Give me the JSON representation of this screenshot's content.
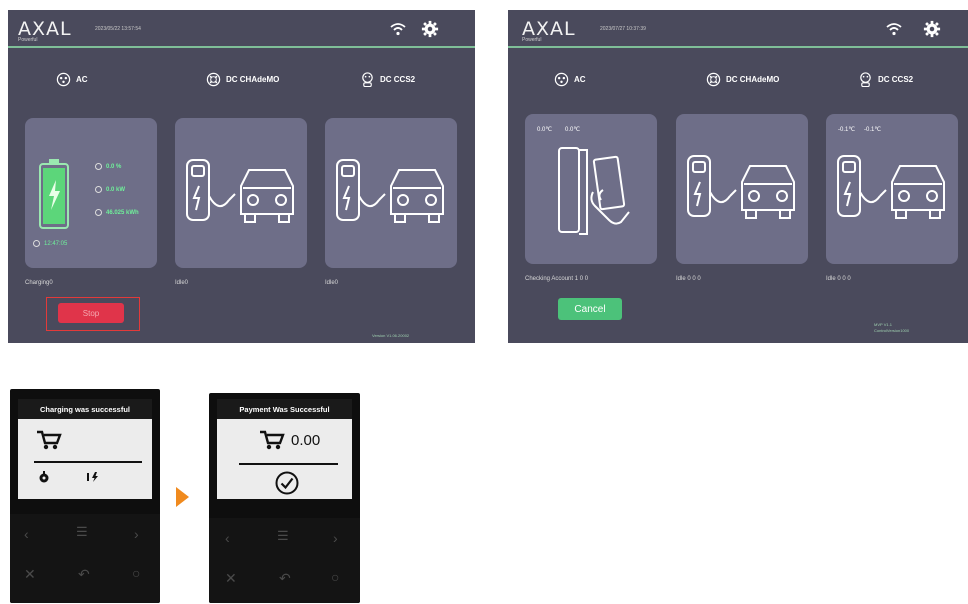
{
  "screen1": {
    "logo": "AXAL",
    "logo_sub": "Powerful",
    "datetime": "2023/05/22 13:57:54",
    "connectors": [
      {
        "label": "AC",
        "icon": "ac-plug-icon"
      },
      {
        "label": "DC CHAdeMO",
        "icon": "chademo-plug-icon"
      },
      {
        "label": "DC CCS2",
        "icon": "ccs2-plug-icon"
      }
    ],
    "metrics": {
      "soc": "0.0 %",
      "power": "0.0 kW",
      "energy": "46.025 kWh"
    },
    "time": "12:47:05",
    "statuses": [
      "Charging0",
      "Idle0",
      "Idle0"
    ],
    "stop_label": "Stop",
    "version": "Version V1.06.20002"
  },
  "screen2": {
    "logo": "AXAL",
    "logo_sub": "Powerful",
    "datetime": "2023/07/27 10:37:39",
    "connectors": [
      {
        "label": "AC",
        "icon": "ac-plug-icon"
      },
      {
        "label": "DC CHAdeMO",
        "icon": "chademo-plug-icon"
      },
      {
        "label": "DC CCS2",
        "icon": "ccs2-plug-icon"
      }
    ],
    "temps_left": [
      "0.0℃",
      "0.0℃"
    ],
    "temps_right": [
      "-0.1℃",
      "-0.1℃"
    ],
    "statuses": [
      "Checking Account 1 0 0",
      "Idle 0 0 0",
      "Idle 0 0 0"
    ],
    "cancel_label": "Cancel",
    "version": [
      "MVP V1.1",
      "ControlVersion1000"
    ]
  },
  "terminal1": {
    "title": "Charging was successful"
  },
  "terminal2": {
    "title": "Payment Was Successful",
    "amount": "0.00"
  },
  "colors": {
    "screen_bg": "#4a4a5c",
    "card_bg": "#6e6e88",
    "accent_green": "#6ff09a",
    "stop_red": "#e0344a",
    "cancel_green": "#4cc27a",
    "arrow_orange": "#f08a1e"
  }
}
